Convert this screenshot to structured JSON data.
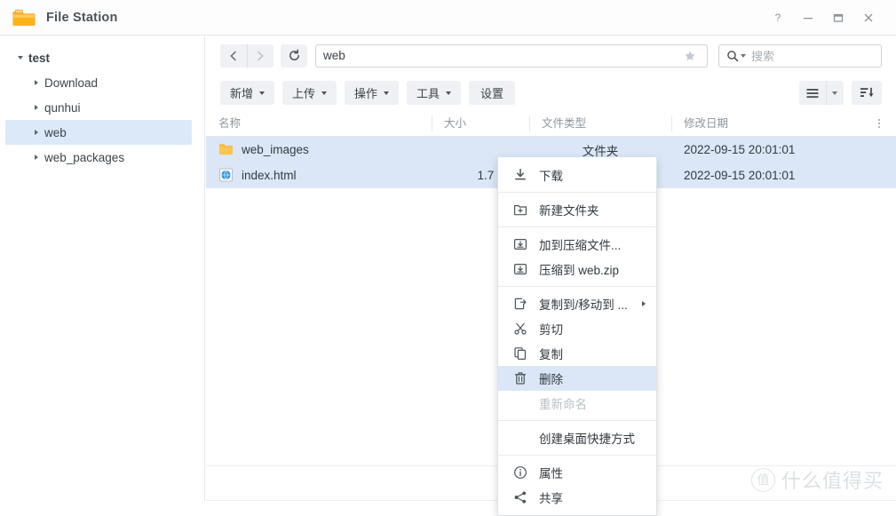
{
  "window": {
    "title": "File Station",
    "app_icon": "folder-icon",
    "controls": [
      {
        "name": "help-button",
        "glyph": "?"
      },
      {
        "name": "minimize-button",
        "glyph": "—"
      },
      {
        "name": "maximize-button",
        "glyph": "▢"
      },
      {
        "name": "close-button",
        "glyph": "✕"
      }
    ]
  },
  "sidebar": {
    "items": [
      {
        "label": "test",
        "level": 0,
        "expanded": true,
        "selected": false
      },
      {
        "label": "Download",
        "level": 1,
        "expanded": false,
        "selected": false
      },
      {
        "label": "qunhui",
        "level": 1,
        "expanded": false,
        "selected": false
      },
      {
        "label": "web",
        "level": 1,
        "expanded": false,
        "selected": true
      },
      {
        "label": "web_packages",
        "level": 1,
        "expanded": false,
        "selected": false
      }
    ]
  },
  "nav": {
    "back_icon": "chevron-left-icon",
    "forward_icon": "chevron-right-icon",
    "refresh_icon": "refresh-icon",
    "path_value": "web",
    "favorite_icon": "star-icon",
    "search_icon": "search-icon",
    "search_placeholder": "搜索"
  },
  "toolbar": {
    "buttons": [
      {
        "label": "新增",
        "caret": true,
        "name": "create-button"
      },
      {
        "label": "上传",
        "caret": true,
        "name": "upload-button"
      },
      {
        "label": "操作",
        "caret": true,
        "name": "action-button"
      },
      {
        "label": "工具",
        "caret": true,
        "name": "tools-button"
      },
      {
        "label": "设置",
        "caret": false,
        "name": "settings-button"
      }
    ],
    "view_icon": "list-view-icon",
    "view_caret_icon": "chevron-down-icon",
    "sort_icon": "sort-descending-icon"
  },
  "filelist": {
    "columns": [
      {
        "label": "名称",
        "key": "name"
      },
      {
        "label": "大小",
        "key": "size"
      },
      {
        "label": "文件类型",
        "key": "type"
      },
      {
        "label": "修改日期",
        "key": "date"
      }
    ],
    "column_menu_icon": "column-options-icon",
    "rows": [
      {
        "icon": "folder-icon",
        "name": "web_images",
        "size": "",
        "type": "文件夹",
        "date": "2022-09-15 20:01:01",
        "selected": true
      },
      {
        "icon": "html-file-icon",
        "name": "index.html",
        "size": "1.7 KB",
        "type": "",
        "date": "2022-09-15 20:01:01",
        "selected": true
      }
    ]
  },
  "context_menu": {
    "items": [
      {
        "label": "下载",
        "icon": "download-icon",
        "state": "normal"
      },
      {
        "type": "separator"
      },
      {
        "label": "新建文件夹",
        "icon": "new-folder-icon",
        "state": "normal"
      },
      {
        "type": "separator"
      },
      {
        "label": "加到压缩文件...",
        "icon": "archive-icon",
        "state": "normal"
      },
      {
        "label": "压缩到 web.zip",
        "icon": "archive-icon",
        "state": "normal"
      },
      {
        "type": "separator"
      },
      {
        "label": "复制到/移动到 ...",
        "icon": "copy-move-icon",
        "state": "normal",
        "submenu": true
      },
      {
        "label": "剪切",
        "icon": "scissors-icon",
        "state": "normal"
      },
      {
        "label": "复制",
        "icon": "copy-icon",
        "state": "normal"
      },
      {
        "label": "删除",
        "icon": "trash-icon",
        "state": "highlighted"
      },
      {
        "label": "重新命名",
        "icon": "",
        "state": "disabled"
      },
      {
        "type": "separator"
      },
      {
        "label": "创建桌面快捷方式",
        "icon": "",
        "state": "normal"
      },
      {
        "type": "separator"
      },
      {
        "label": "属性",
        "icon": "info-icon",
        "state": "normal"
      },
      {
        "label": "共享",
        "icon": "share-icon",
        "state": "normal"
      }
    ]
  },
  "watermark": {
    "logo": "值",
    "text": "什么值得买"
  },
  "colors": {
    "selection": "#dbe7f6",
    "sidebar_selection": "#dce9f8",
    "button_bg": "#eff1f4",
    "folder": "#f7b733",
    "border": "#e4e6e8"
  }
}
